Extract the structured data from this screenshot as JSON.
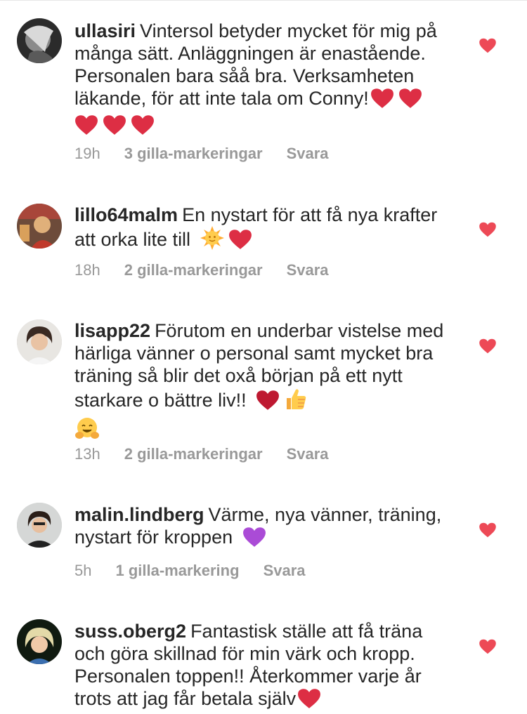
{
  "colors": {
    "text": "#262626",
    "meta": "#999999",
    "like_heart": "#ED4956",
    "emoji_heart_red": "#DD2E44",
    "emoji_heart_purple": "#AA4BD6",
    "divider": "#e6e6e6"
  },
  "comments": [
    {
      "username": "ullasiri",
      "text": "Vintersol betyder mycket för mig på många sätt. Anläggningen är enastående. Personalen bara såå bra. Verksamheten läkande, för att inte tala om Conny!",
      "emojis": [
        "red-heart",
        "red-heart",
        "red-heart",
        "red-heart",
        "red-heart"
      ],
      "time": "19h",
      "likes": "3 gilla-markeringar",
      "reply": "Svara",
      "liked": true
    },
    {
      "username": "lillo64malm",
      "text": "En nystart för att få nya krafter att orka lite till",
      "emojis": [
        "sun-with-face",
        "red-heart"
      ],
      "time": "18h",
      "likes": "2 gilla-markeringar",
      "reply": "Svara",
      "liked": true
    },
    {
      "username": "lisapp22",
      "text": "Förutom en underbar vistelse med härliga vänner o personal samt mycket bra träning så blir det oxå början på ett nytt starkare o bättre liv!!",
      "emojis": [
        "red-heart",
        "thumbs-up",
        "hugging-face"
      ],
      "time": "13h",
      "likes": "2 gilla-markeringar",
      "reply": "Svara",
      "liked": true
    },
    {
      "username": "malin.lindberg",
      "text": "Värme, nya vänner, träning, nystart för kroppen",
      "emojis": [
        "purple-heart"
      ],
      "time": "5h",
      "likes": "1 gilla-markering",
      "reply": "Svara",
      "liked": true
    },
    {
      "username": "suss.oberg2",
      "text": "Fantastisk ställe att få träna och göra skillnad för min värk och kropp. Personalen toppen!! Återkommer varje år trots att jag får betala själv",
      "emojis": [
        "red-heart"
      ],
      "time": "",
      "likes": "",
      "reply": "",
      "liked": true
    }
  ]
}
